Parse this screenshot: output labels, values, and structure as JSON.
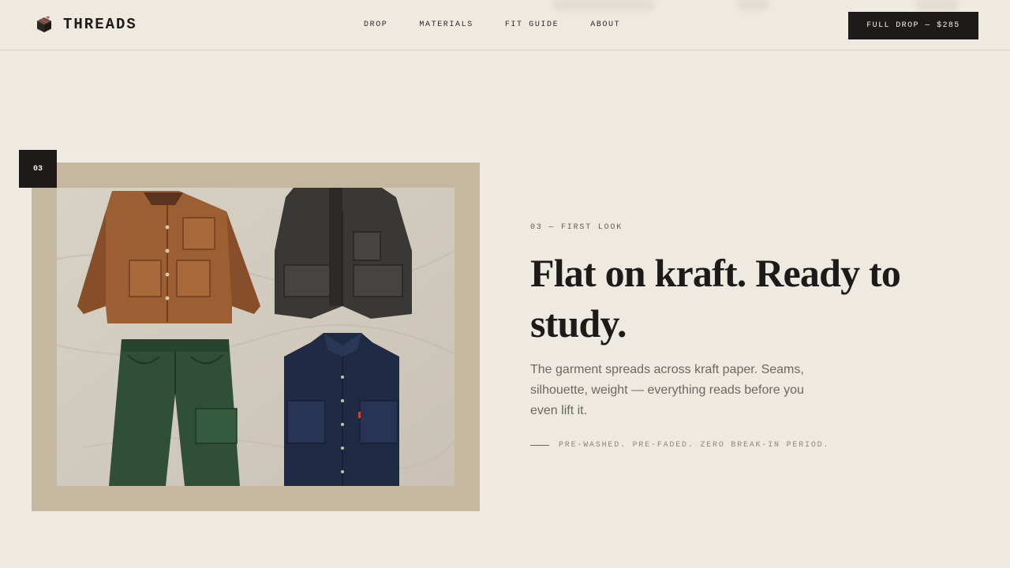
{
  "brand": {
    "name": "THREADS",
    "icon": "box-icon"
  },
  "nav": {
    "items": [
      {
        "label": "DROP"
      },
      {
        "label": "MATERIALS"
      },
      {
        "label": "FIT GUIDE"
      },
      {
        "label": "ABOUT"
      }
    ]
  },
  "cta": {
    "label": "FULL DROP — $285"
  },
  "feature": {
    "badge": "03",
    "eyebrow": "03 — FIRST LOOK",
    "headline": "Flat on kraft. Ready to study.",
    "body": "The garment spreads across kraft paper. Seams, silhouette, weight — everything reads before you even lift it.",
    "note": "PRE-WASHED. PRE-FADED. ZERO BREAK-IN PERIOD."
  },
  "colors": {
    "background": "#eeeae2",
    "ink": "#1c1b19",
    "kraft_frame": "#c6b89f",
    "accent_red": "#c8452f"
  }
}
